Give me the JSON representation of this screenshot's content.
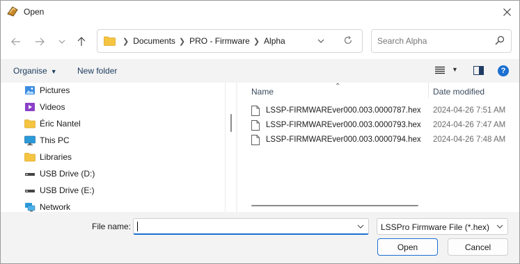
{
  "window": {
    "title": "Open"
  },
  "nav": {
    "back_icon": "arrow-left-icon",
    "forward_icon": "arrow-right-icon",
    "recent_icon": "chevron-down-icon",
    "up_icon": "arrow-up-icon",
    "breadcrumb": [
      "Documents",
      "PRO - Firmware",
      "Alpha"
    ],
    "search_placeholder": "Search Alpha"
  },
  "commands": {
    "organise": "Organise",
    "new_folder": "New folder"
  },
  "sidebar": {
    "items": [
      {
        "label": "Pictures",
        "icon": "pictures-icon"
      },
      {
        "label": "Videos",
        "icon": "videos-icon"
      },
      {
        "label": "Éric Nantel",
        "icon": "folder-icon"
      },
      {
        "label": "This PC",
        "icon": "computer-icon"
      },
      {
        "label": "Libraries",
        "icon": "folder-icon"
      },
      {
        "label": "USB Drive (D:)",
        "icon": "usb-drive-icon"
      },
      {
        "label": "USB Drive (E:)",
        "icon": "usb-drive-icon"
      },
      {
        "label": "Network",
        "icon": "network-icon"
      }
    ]
  },
  "filelist": {
    "columns": {
      "name": "Name",
      "date": "Date modified"
    },
    "files": [
      {
        "name": "LSSP-FIRMWAREver000.003.0000787.hex",
        "date": "2024-04-26 7:51 AM"
      },
      {
        "name": "LSSP-FIRMWAREver000.003.0000793.hex",
        "date": "2024-04-26 7:47 AM"
      },
      {
        "name": "LSSP-FIRMWAREver000.003.0000794.hex",
        "date": "2024-04-26 7:48 AM"
      }
    ]
  },
  "bottom": {
    "file_name_label": "File name:",
    "file_name_value": "",
    "filter": "LSSPro Firmware File (*.hex)",
    "open_label": "Open",
    "cancel_label": "Cancel"
  },
  "colors": {
    "accent": "#1a6fd1",
    "folder": "#f5c542"
  }
}
